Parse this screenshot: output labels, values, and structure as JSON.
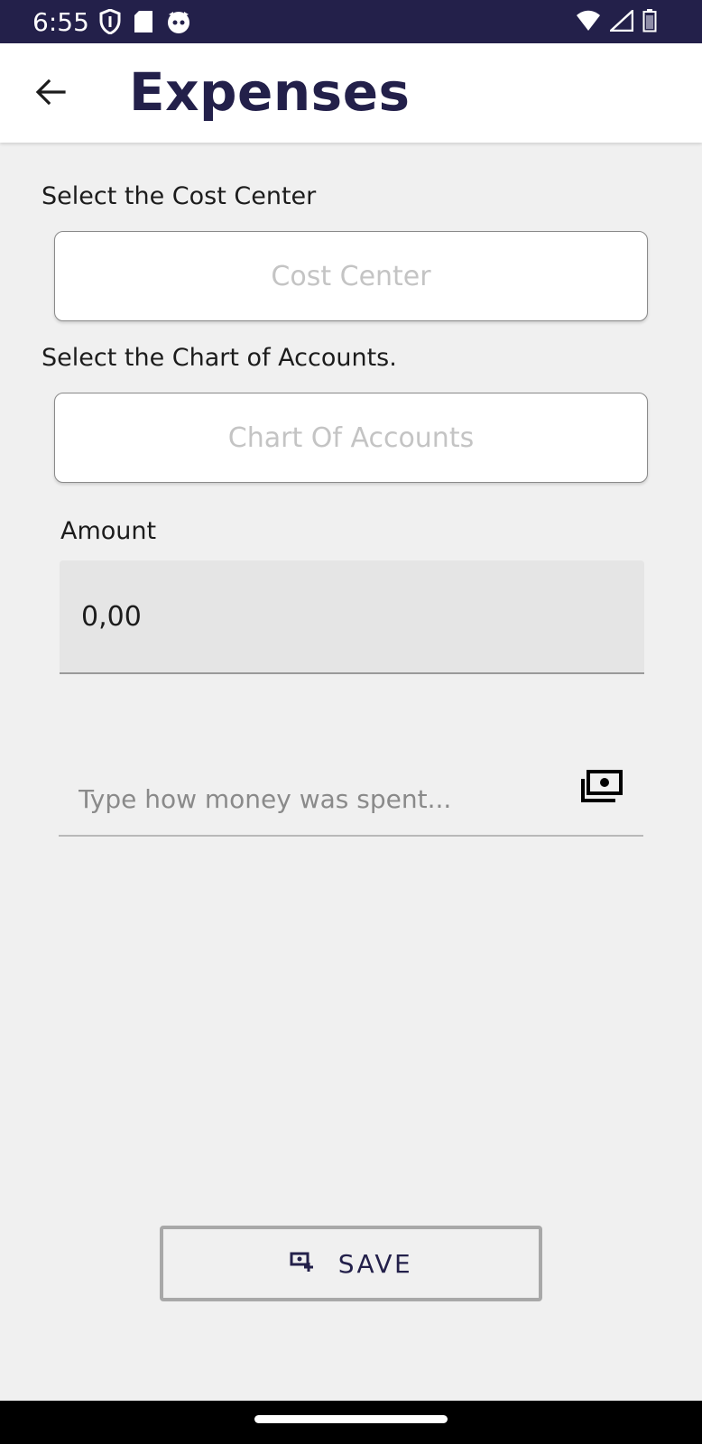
{
  "status_bar": {
    "time": "6:55",
    "icons_left": [
      "shield-icon",
      "sd-card-icon",
      "cat-face-icon"
    ],
    "icons_right": [
      "wifi-icon",
      "cell-signal-icon",
      "battery-icon"
    ]
  },
  "app_bar": {
    "back_icon": "arrow-left-icon",
    "title": "Expenses"
  },
  "form": {
    "cost_center": {
      "label": "Select the Cost Center",
      "placeholder": "Cost Center"
    },
    "chart_of_accounts": {
      "label": "Select the Chart of Accounts.",
      "placeholder": "Chart Of Accounts"
    },
    "amount": {
      "label": "Amount",
      "value": "0,00"
    },
    "description": {
      "placeholder": "Type how money was spent...",
      "icon": "money-icon"
    }
  },
  "save_button": {
    "label": "SAVE",
    "icon": "add-money-icon"
  },
  "colors": {
    "primary": "#23204a",
    "background": "#f0f0f0",
    "field_fill": "#e5e5e5"
  }
}
